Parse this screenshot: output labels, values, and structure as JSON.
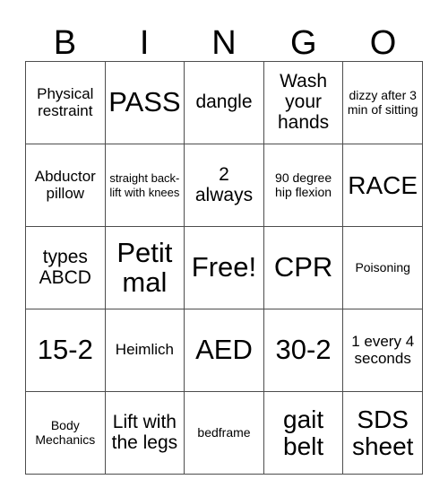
{
  "card": {
    "title": "BINGO",
    "headers": [
      "B",
      "I",
      "N",
      "G",
      "O"
    ],
    "rows": [
      [
        {
          "text": "Physical restraint",
          "size": "sm"
        },
        {
          "text": "PASS",
          "size": "xl"
        },
        {
          "text": "dangle",
          "size": "md"
        },
        {
          "text": "Wash your hands",
          "size": "md"
        },
        {
          "text": "dizzy after 3 min of sitting",
          "size": "xs"
        }
      ],
      [
        {
          "text": "Abductor pillow",
          "size": "sm"
        },
        {
          "text": "straight back- lift with knees",
          "size": "xxs"
        },
        {
          "text": "2 always",
          "size": "md"
        },
        {
          "text": "90 degree hip flexion",
          "size": "xs"
        },
        {
          "text": "RACE",
          "size": "lg"
        }
      ],
      [
        {
          "text": "types ABCD",
          "size": "md"
        },
        {
          "text": "Petit mal",
          "size": "xl"
        },
        {
          "text": "Free!",
          "size": "xl"
        },
        {
          "text": "CPR",
          "size": "xl"
        },
        {
          "text": "Poisoning",
          "size": "xs"
        }
      ],
      [
        {
          "text": "15-2",
          "size": "xl"
        },
        {
          "text": "Heimlich",
          "size": "sm"
        },
        {
          "text": "AED",
          "size": "xl"
        },
        {
          "text": "30-2",
          "size": "xl"
        },
        {
          "text": "1 every 4 seconds",
          "size": "sm"
        }
      ],
      [
        {
          "text": "Body Mechanics",
          "size": "xs"
        },
        {
          "text": "Lift with the legs",
          "size": "md"
        },
        {
          "text": "bedframe",
          "size": "xs"
        },
        {
          "text": "gait belt",
          "size": "lg"
        },
        {
          "text": "SDS sheet",
          "size": "lg"
        }
      ]
    ],
    "colors": {
      "background": "#ffffff",
      "text": "#000000",
      "border": "#4d4d4d"
    }
  }
}
